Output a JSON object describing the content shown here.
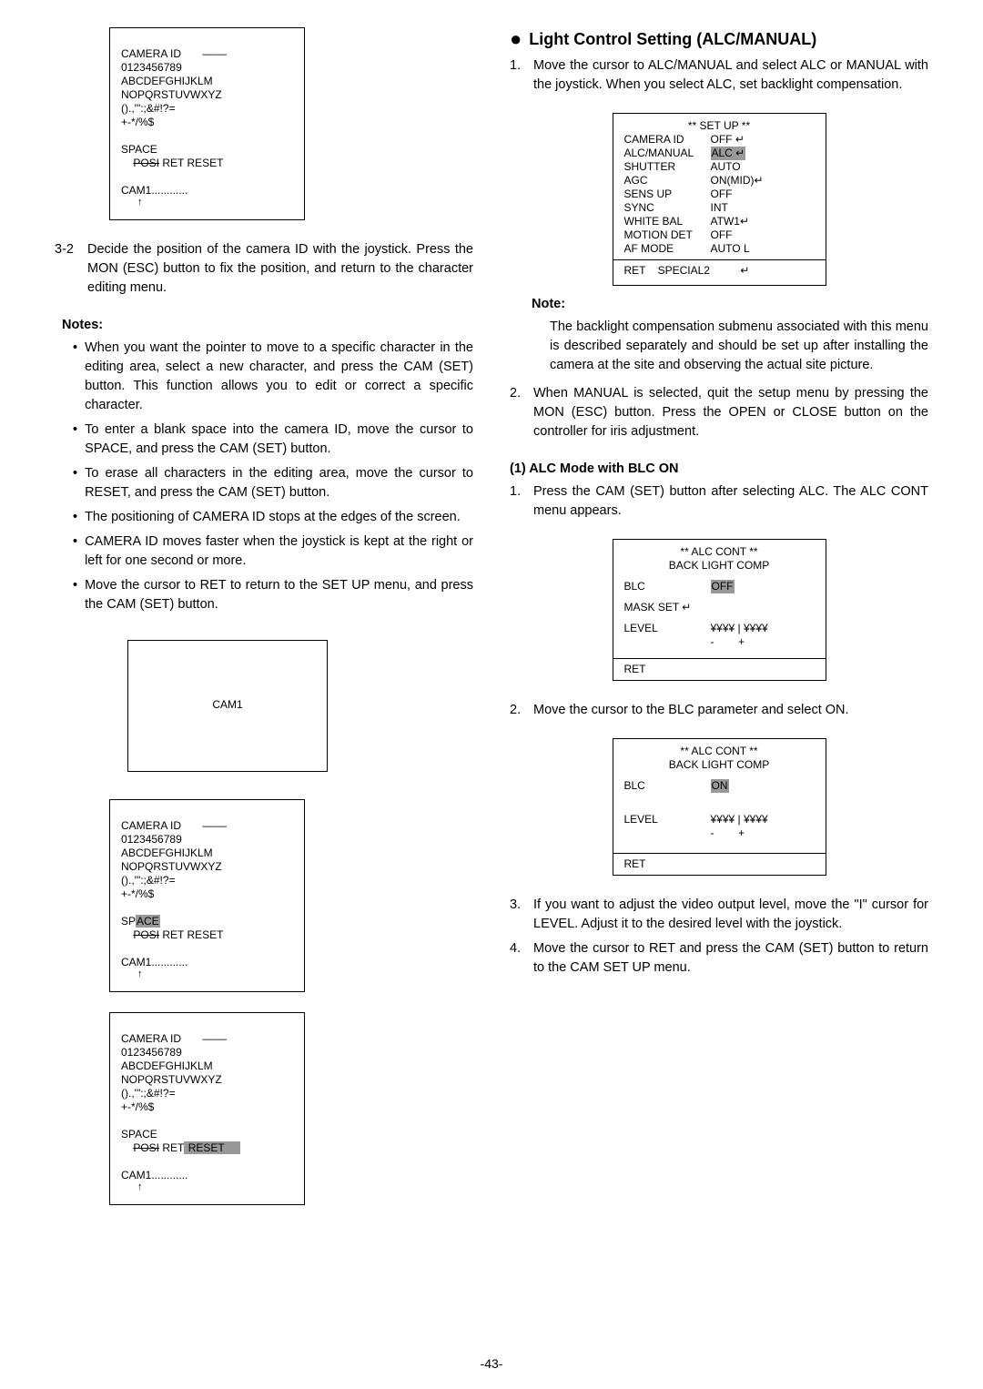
{
  "left": {
    "screen1": {
      "l1": "CAMERA ID       ––––",
      "l2": "0123456789",
      "l3": "ABCDEFGHIJKLM",
      "l4": "NOPQRSTUVWXYZ",
      "l5": "().,'\":;&#!?=",
      "l6": "+-*/%$",
      "space": "SPACE",
      "posi": "POSI",
      "rest": " RET RESET",
      "cam": "CAM1............",
      "arrow": "↑"
    },
    "step3_2_num": "3-2",
    "step3_2": "Decide the position of the camera ID with the joystick. Press the MON (ESC) button to fix the position, and return to the character editing menu.",
    "notes_heading": "Notes:",
    "notes": [
      "When you want the pointer to move to a specific character in the editing area, select a new character, and press the CAM (SET) button. This function allows you to edit or correct a specific character.",
      "To enter a blank space into the camera ID, move the cursor to SPACE, and press the CAM (SET) button.",
      "To erase all characters in the editing area, move the cursor to RESET, and press the CAM (SET) button.",
      "The positioning of CAMERA ID stops at the edges of the screen.",
      "CAMERA ID moves faster when the joystick is kept at the right or left for one second or more.",
      "Move the cursor to RET to return to the SET UP menu, and press the CAM (SET) button."
    ],
    "camBox": "CAM1",
    "screen2": {
      "space_hl": "ACE",
      "space_pre": "SP"
    },
    "screen3": {
      "rest_hl": " RESET     ",
      "rest_pre": " RET"
    }
  },
  "right": {
    "title": "Light Control Setting (ALC/MANUAL)",
    "step1_num": "1.",
    "step1": "Move the cursor to ALC/MANUAL and select ALC or MANUAL with the joystick. When you select ALC, set backlight compensation.",
    "setupMenu": {
      "title": "** SET UP **",
      "rows": [
        [
          "CAMERA ID",
          "OFF ↵"
        ],
        [
          "ALC/MANUAL",
          "ALC ↵",
          true
        ],
        [
          "SHUTTER",
          "AUTO"
        ],
        [
          "AGC",
          "ON(MID)↵"
        ],
        [
          "SENS UP",
          "OFF"
        ],
        [
          "SYNC",
          "INT"
        ],
        [
          "WHITE BAL",
          "ATW1↵"
        ],
        [
          "MOTION DET",
          "OFF"
        ],
        [
          "AF MODE",
          "AUTO L"
        ]
      ],
      "bottom": "RET    SPECIAL2          ↵"
    },
    "note_heading": "Note:",
    "note_body": "The backlight compensation submenu associated with this menu is described separately and should be set up after installing the camera at the site and observing the actual site picture.",
    "step2_num": "2.",
    "step2": "When MANUAL is selected, quit the setup menu by pressing the MON (ESC) button. Press the OPEN or CLOSE button on the controller for iris adjustment.",
    "sub_heading": "(1) ALC Mode with BLC ON",
    "sub1_num": "1.",
    "sub1": "Press the CAM (SET) button after selecting ALC. The ALC CONT menu appears.",
    "alc1": {
      "title1": "** ALC CONT **",
      "title2": "BACK LIGHT COMP",
      "blc_label": "BLC",
      "blc_val": "OFF",
      "mask": "MASK SET ↵",
      "level_label": "LEVEL",
      "level_scale": "¥¥¥¥ | ¥¥¥¥",
      "level_signs": "-        +",
      "ret": "RET"
    },
    "sub2_num": "2.",
    "sub2": "Move the cursor to the BLC parameter and select ON.",
    "alc2": {
      "blc_val": "ON"
    },
    "sub3_num": "3.",
    "sub3": "If you want to adjust the video output level, move the \"I\" cursor for LEVEL. Adjust it to the desired level with the joystick.",
    "sub4_num": "4.",
    "sub4": "Move the cursor to RET and press the CAM (SET) button to return to the CAM SET UP menu."
  },
  "pageNum": "-43-"
}
